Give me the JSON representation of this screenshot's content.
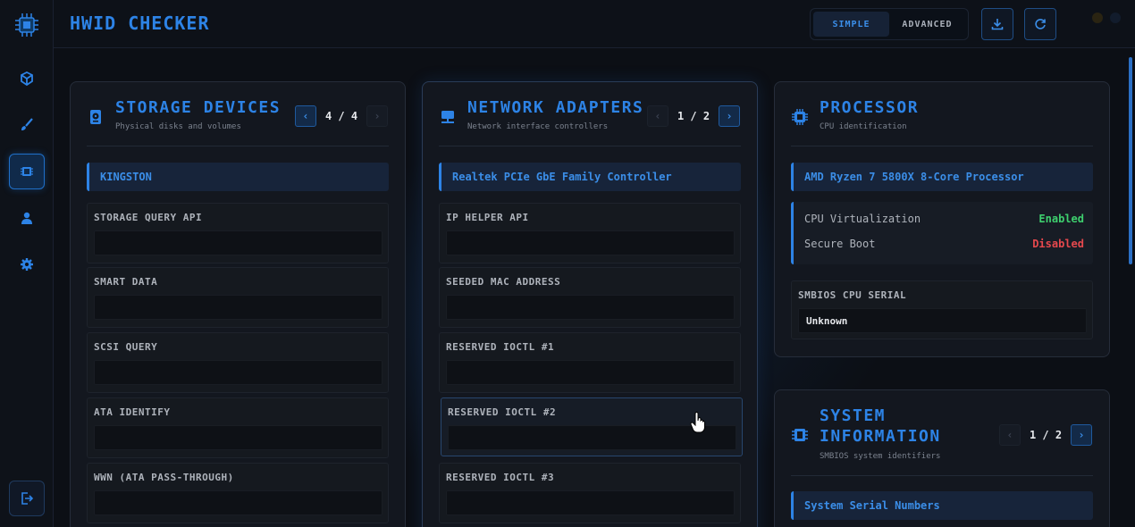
{
  "app": {
    "title": "HWID CHECKER"
  },
  "header": {
    "modes": [
      {
        "label": "SIMPLE",
        "active": true
      },
      {
        "label": "ADVANCED",
        "active": false
      }
    ],
    "download_icon": "download-icon",
    "refresh_icon": "refresh-icon",
    "accent": "#2d83e6"
  },
  "sidebar": {
    "items": [
      {
        "icon": "cube-icon",
        "active": false
      },
      {
        "icon": "brush-icon",
        "active": false
      },
      {
        "icon": "chip-icon",
        "active": true
      },
      {
        "icon": "user-icon",
        "active": false
      },
      {
        "icon": "gear-icon",
        "active": false
      }
    ],
    "logout_icon": "logout-icon"
  },
  "storage": {
    "title": "STORAGE DEVICES",
    "subtitle": "Physical disks and volumes",
    "pager": "4 / 4",
    "device": "KINGSTON",
    "fields": [
      {
        "label": "STORAGE QUERY API",
        "value": ""
      },
      {
        "label": "SMART DATA",
        "value": ""
      },
      {
        "label": "SCSI QUERY",
        "value": ""
      },
      {
        "label": "ATA IDENTIFY",
        "value": ""
      },
      {
        "label": "WWN (ATA PASS-THROUGH)",
        "value": ""
      }
    ]
  },
  "network": {
    "title": "NETWORK ADAPTERS",
    "subtitle": "Network interface controllers",
    "pager": "1 / 2",
    "device": "Realtek PCIe GbE Family Controller",
    "fields": [
      {
        "label": "IP HELPER API",
        "value": ""
      },
      {
        "label": "SEEDED MAC ADDRESS",
        "value": ""
      },
      {
        "label": "RESERVED IOCTL #1",
        "value": ""
      },
      {
        "label": "RESERVED IOCTL #2",
        "value": ""
      },
      {
        "label": "RESERVED IOCTL #3",
        "value": ""
      }
    ]
  },
  "processor": {
    "title": "PROCESSOR",
    "subtitle": "CPU identification",
    "device": "AMD Ryzen 7 5800X 8-Core Processor",
    "statuses": [
      {
        "label": "CPU Virtualization",
        "value": "Enabled",
        "color": "#3ecf6e"
      },
      {
        "label": "Secure Boot",
        "value": "Disabled",
        "color": "#e5484d"
      }
    ],
    "serial_label": "SMBIOS CPU SERIAL",
    "serial_value": "Unknown"
  },
  "system": {
    "title_line1": "SYSTEM",
    "title_line2": "INFORMATION",
    "subtitle": "SMBIOS system identifiers",
    "pager": "1 / 2",
    "section": "System Serial Numbers"
  }
}
